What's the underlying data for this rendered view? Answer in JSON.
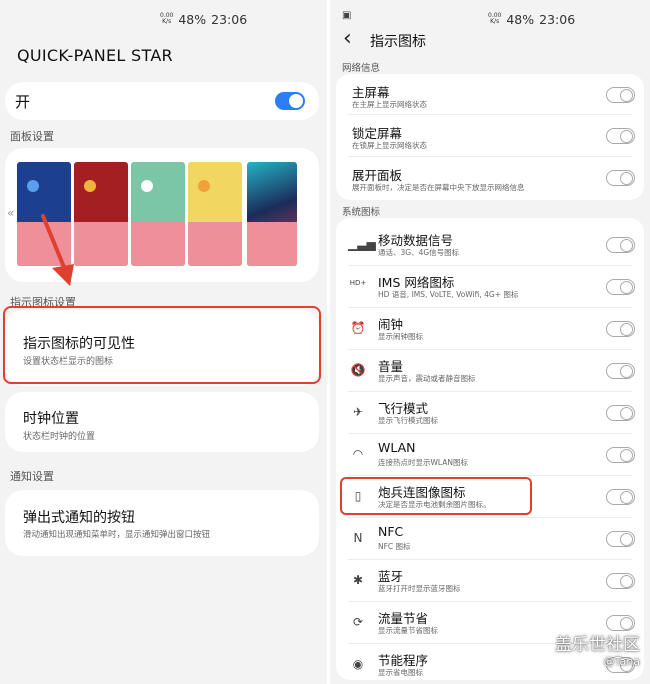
{
  "left": {
    "status": {
      "speed_top": "0.00",
      "speed_bottom": "K/s",
      "battery": "48%",
      "time": "23:06"
    },
    "app_title": "QUICK-PANEL STAR",
    "master_toggle": {
      "label": "开",
      "state": "on"
    },
    "panel_settings_label": "面板设置",
    "indicator_settings_label": "指示图标设置",
    "visibility": {
      "title": "指示图标的可见性",
      "subtitle": "设置状态栏显示的图标"
    },
    "clock": {
      "title": "时钟位置",
      "subtitle": "状态栏时钟的位置"
    },
    "notification_label": "通知设置",
    "popup": {
      "title": "弹出式通知的按钮",
      "subtitle": "滑动通知出现通知菜单时，显示通知弹出窗口按钮"
    },
    "thumb_colors": [
      "#1d3f8f",
      "#a31f22",
      "#7ac6a6",
      "#f1d661"
    ],
    "accent": "#2d7df6",
    "highlight_color": "#e0412f"
  },
  "right": {
    "status": {
      "speed_top": "0.00",
      "speed_bottom": "K/s",
      "battery": "48%",
      "time": "23:06"
    },
    "back": "‹",
    "title": "指示图标",
    "network_label": "网络信息",
    "network_items": [
      {
        "title": "主屏幕",
        "subtitle": "在主屏上显示网络状态"
      },
      {
        "title": "锁定屏幕",
        "subtitle": "在锁屏上显示网络状态"
      },
      {
        "title": "展开面板",
        "subtitle": "展开面板时，决定是否在屏幕中央下放显示网络信息"
      }
    ],
    "system_label": "系统图标",
    "system_items": [
      {
        "icon": "signal-icon",
        "glyph": "▁▃▅",
        "title": "移动数据信号",
        "subtitle": "通话、3G、4G信号图标"
      },
      {
        "icon": "hd-plus-icon",
        "glyph": "HD+",
        "title": "IMS 网络图标",
        "subtitle": "HD 语音, IMS, VoLTE, VoWifi, 4G+ 图标"
      },
      {
        "icon": "alarm-icon",
        "glyph": "⏰",
        "title": "闹钟",
        "subtitle": "显示闹钟图标"
      },
      {
        "icon": "volume-mute-icon",
        "glyph": "🔇",
        "title": "音量",
        "subtitle": "显示声音，震动或者静音图标"
      },
      {
        "icon": "airplane-icon",
        "glyph": "✈",
        "title": "飞行模式",
        "subtitle": "显示飞行模式图标"
      },
      {
        "icon": "wifi-icon",
        "glyph": "◠",
        "title": "WLAN",
        "subtitle": "连接热点时显示WLAN图标"
      },
      {
        "icon": "battery-icon",
        "glyph": "▯",
        "title": "炮兵连图像图标",
        "subtitle": "决定是否显示电池剩余图片图标。"
      },
      {
        "icon": "nfc-icon",
        "glyph": "N",
        "title": "NFC",
        "subtitle": "NFC 图标"
      },
      {
        "icon": "bluetooth-icon",
        "glyph": "✱",
        "title": "蓝牙",
        "subtitle": "蓝牙打开时显示蓝牙图标"
      },
      {
        "icon": "data-saver-icon",
        "glyph": "⟳",
        "title": "流量节省",
        "subtitle": "显示流量节省图标"
      },
      {
        "icon": "power-saving-icon",
        "glyph": "◉",
        "title": "节能程序",
        "subtitle": "显示省电图标"
      }
    ]
  },
  "watermark": {
    "brand": "盖乐世社区",
    "user": "@Tana"
  }
}
